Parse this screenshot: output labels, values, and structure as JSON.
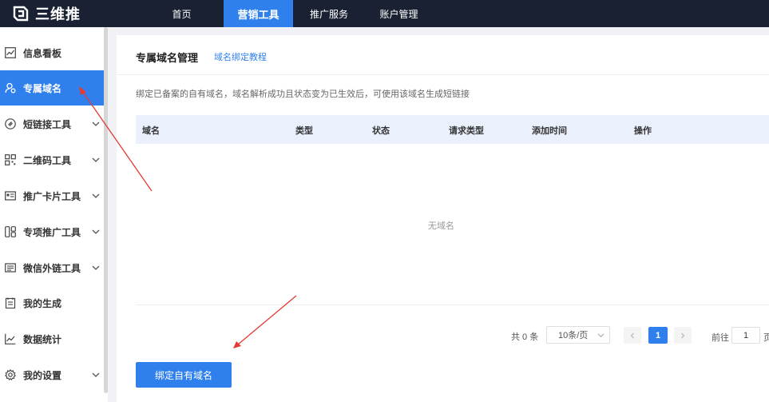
{
  "app": {
    "name": "三维推"
  },
  "topnav": {
    "items": [
      {
        "label": "首页",
        "active": false
      },
      {
        "label": "营销工具",
        "active": true
      },
      {
        "label": "推广服务",
        "active": false
      },
      {
        "label": "账户管理",
        "active": false
      }
    ]
  },
  "sidebar": {
    "items": [
      {
        "label": "信息看板",
        "icon": "chart-icon",
        "has_submenu": false,
        "active": false
      },
      {
        "label": "专属域名",
        "icon": "domain-user-icon",
        "has_submenu": false,
        "active": true
      },
      {
        "label": "短链接工具",
        "icon": "link-icon",
        "has_submenu": true,
        "active": false
      },
      {
        "label": "二维码工具",
        "icon": "qrcode-icon",
        "has_submenu": true,
        "active": false
      },
      {
        "label": "推广卡片工具",
        "icon": "card-icon",
        "has_submenu": true,
        "active": false
      },
      {
        "label": "专项推广工具",
        "icon": "tool-icon",
        "has_submenu": true,
        "active": false
      },
      {
        "label": "微信外链工具",
        "icon": "wechat-card-icon",
        "has_submenu": true,
        "active": false
      },
      {
        "label": "我的生成",
        "icon": "list-icon",
        "has_submenu": false,
        "active": false
      },
      {
        "label": "数据统计",
        "icon": "stats-icon",
        "has_submenu": false,
        "active": false
      },
      {
        "label": "我的设置",
        "icon": "gear-icon",
        "has_submenu": true,
        "active": false
      }
    ]
  },
  "main": {
    "title": "专属域名管理",
    "tutorial_link": "域名绑定教程",
    "description": "绑定已备案的自有域名，域名解析成功且状态变为已生效后，可使用该域名生成短链接",
    "table": {
      "columns": [
        "域名",
        "类型",
        "状态",
        "请求类型",
        "添加时间",
        "操作"
      ],
      "rows": [],
      "empty_text": "无域名"
    },
    "pagination": {
      "total_text": "共 0 条",
      "page_size": "10条/页",
      "current_page": "1",
      "goto_prefix": "前往",
      "goto_value": "1",
      "goto_suffix": "页"
    },
    "bind_button": "绑定自有域名"
  },
  "colors": {
    "primary": "#2f80ed",
    "topbar": "#1a2133",
    "annotation": "#e53935"
  }
}
